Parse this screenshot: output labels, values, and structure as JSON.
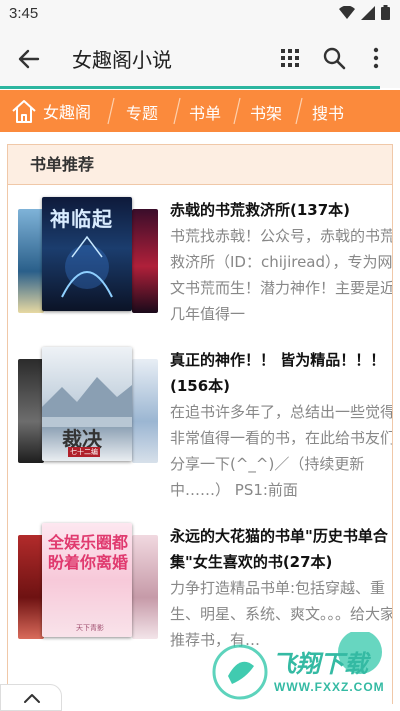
{
  "status_bar": {
    "time": "3:45"
  },
  "app_bar": {
    "title": "女趣阁小说"
  },
  "nav": {
    "home_label": "女趣阁",
    "items": [
      "专题",
      "书单",
      "书架",
      "搜书"
    ]
  },
  "panel": {
    "header": "书单推荐"
  },
  "booklists": [
    {
      "title": "赤戟的书荒救济所(137本)",
      "description": "书荒找赤戟！公众号，赤戟的书荒救济所（ID：chijiread），专为网文书荒而生！潜力神作！主要是近几年值得一",
      "cover_text": "神临起",
      "cover_subtext": "神临起"
    },
    {
      "title": "真正的神作！！ 皆为精品！！！(156本)",
      "description": "在追书许多年了，总结出一些觉得非常值得一看的书，在此给书友们分享一下(^_^)／（持续更新中……） PS1:前面",
      "cover_text": "裁决",
      "cover_subtext": "七十二编"
    },
    {
      "title": "永远的大花猫的书单\"历史书单合集\"女生喜欢的书(27本)",
      "description": "力争打造精品书单:包括穿越、重生、明星、系统、爽文。。。给大家推荐书，有…",
      "cover_text": "全娱乐圈都盼着你离婚",
      "cover_subtext": "天下青影"
    }
  ],
  "watermark": {
    "text": "飞翔下载",
    "url": "WWW.FXXZ.COM"
  },
  "colors": {
    "accent": "#fb8a3c",
    "progress": "#2cb6a0"
  }
}
